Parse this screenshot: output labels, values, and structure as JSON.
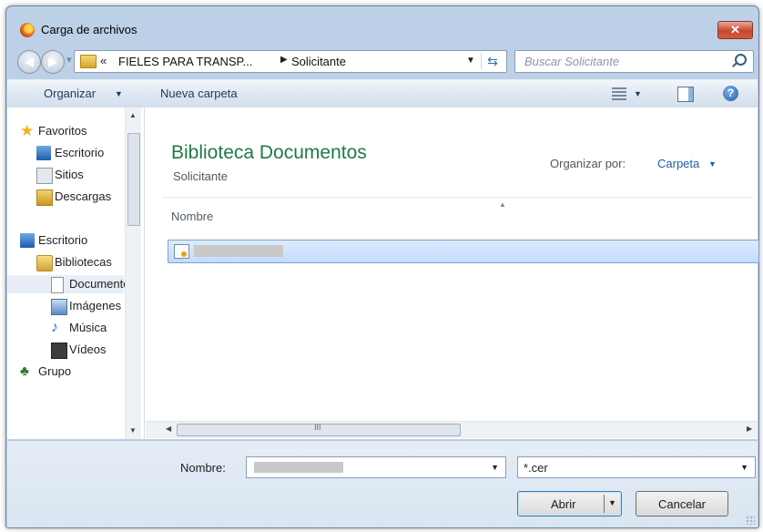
{
  "window": {
    "title": "Carga de archivos",
    "close_glyph": "✕"
  },
  "address": {
    "chevrons": "«",
    "crumbs": [
      "FIELES PARA TRANSP...",
      "Solicitante"
    ],
    "separator": "▶",
    "dropdown_glyph": "▼",
    "refresh_glyph": "⇆",
    "search_placeholder": "Buscar Solicitante",
    "back_glyph": "◀",
    "forward_glyph": "▶",
    "history_glyph": "▼"
  },
  "toolbar": {
    "organize_label": "Organizar",
    "arrow": "▼",
    "new_folder_label": "Nueva carpeta",
    "help_glyph": "?"
  },
  "nav": {
    "items": [
      {
        "label": "Favoritos",
        "icon": "star-icon"
      },
      {
        "label": "Escritorio",
        "icon": "desktop-icon"
      },
      {
        "label": "Sitios",
        "icon": "sites-icon"
      },
      {
        "label": "Descargas",
        "icon": "downloads-icon"
      },
      {
        "label": "Escritorio",
        "icon": "desktop-icon"
      },
      {
        "label": "Bibliotecas",
        "icon": "library-icon"
      },
      {
        "label": "Documentos",
        "icon": "document-icon"
      },
      {
        "label": "Imágenes",
        "icon": "pictures-icon"
      },
      {
        "label": "Música",
        "icon": "music-icon"
      },
      {
        "label": "Vídeos",
        "icon": "video-icon"
      },
      {
        "label": "Grupo",
        "icon": "homegroup-icon"
      }
    ],
    "scroll_up": "▲",
    "scroll_down": "▼"
  },
  "main": {
    "library_title": "Biblioteca Documentos",
    "library_subtitle": "Solicitante",
    "arrange_label": "Organizar por:",
    "arrange_value": "Carpeta",
    "arrange_arrow": "▼",
    "sort_glyph": "▲",
    "column_name": "Nombre",
    "files": [
      {
        "icon": "certificate-icon",
        "name_redacted": true
      }
    ],
    "hscroll_left": "◀",
    "hscroll_grip": "III",
    "hscroll_right": "▶"
  },
  "bottom": {
    "filename_label": "Nombre:",
    "filename_drop": "▼",
    "filetype_value": "*.cer",
    "filetype_drop": "▼",
    "open_label": "Abrir",
    "open_arrow": "▼",
    "cancel_label": "Cancelar"
  },
  "colors": {
    "library_title": "#1e7a45",
    "link_blue": "#1e5eaa",
    "selection": "#c1dcfc"
  }
}
